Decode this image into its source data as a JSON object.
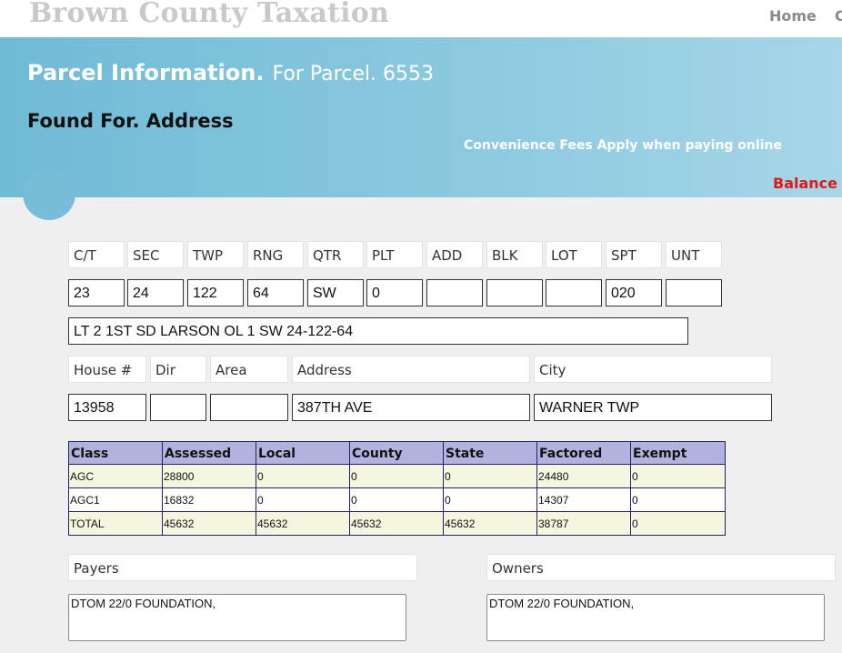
{
  "header": {
    "site_title": "Brown County Taxation",
    "nav_home": "Home",
    "nav_next_partial": "C"
  },
  "banner": {
    "heading_bold": "Parcel Information.",
    "heading_light": "For Parcel. 6553",
    "found_text": "Found For. Address",
    "fees_notice": "Convenience Fees Apply when paying online",
    "balance_label": "Balance ="
  },
  "legal": {
    "labels": [
      "C/T",
      "SEC",
      "TWP",
      "RNG",
      "QTR",
      "PLT",
      "ADD",
      "BLK",
      "LOT",
      "SPT",
      "UNT"
    ],
    "values": [
      "23",
      "24",
      "122",
      "64",
      "SW",
      "0",
      "",
      "",
      "",
      "020",
      ""
    ]
  },
  "legal_description": "LT 2 1ST SD LARSON OL 1 SW 24-122-64",
  "address": {
    "labels": [
      "House #",
      "Dir",
      "Area",
      "Address",
      "City"
    ],
    "values": [
      "13958",
      "",
      "",
      "387TH AVE",
      "WARNER TWP"
    ]
  },
  "tax_table": {
    "headers": [
      "Class",
      "Assessed",
      "Local",
      "County",
      "State",
      "Factored",
      "Exempt"
    ],
    "rows": [
      [
        "AGC",
        "28800",
        "0",
        "0",
        "0",
        "24480",
        "0"
      ],
      [
        "AGC1",
        "16832",
        "0",
        "0",
        "0",
        "14307",
        "0"
      ],
      [
        "TOTAL",
        "45632",
        "45632",
        "45632",
        "45632",
        "38787",
        "0"
      ]
    ]
  },
  "payers": {
    "label": "Payers",
    "value": "DTOM 22/0 FOUNDATION,"
  },
  "owners": {
    "label": "Owners",
    "value": "DTOM 22/0 FOUNDATION,"
  }
}
